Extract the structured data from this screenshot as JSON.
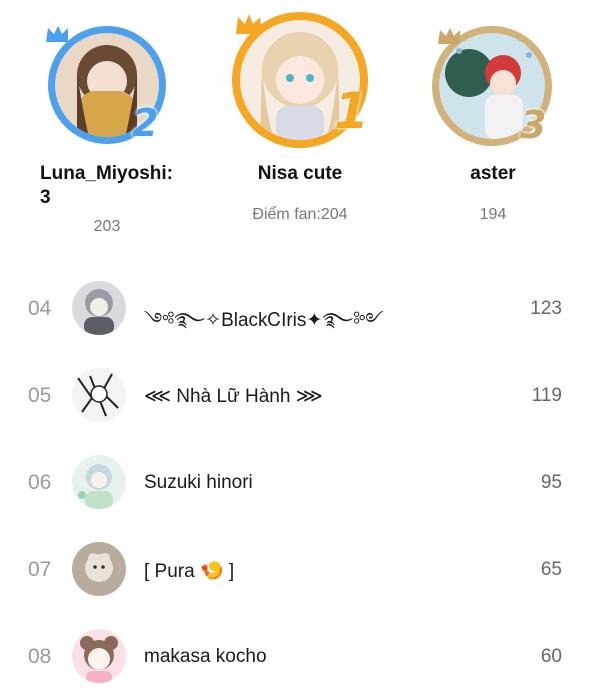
{
  "podium": [
    {
      "rank": "2",
      "name": "Luna_Miyoshi:\n3",
      "score": "203"
    },
    {
      "rank": "1",
      "name": "Nisa cute",
      "score": "Điểm fan:204"
    },
    {
      "rank": "3",
      "name": "aster",
      "score": "194"
    }
  ],
  "list": [
    {
      "rank": "04",
      "name": "༺࿐✧BlackᏟIris✦࿐༻",
      "score": "123"
    },
    {
      "rank": "05",
      "name": "⋘ Nhà Lữ Hành ⋙",
      "score": "119"
    },
    {
      "rank": "06",
      "name": "Suzuki hinori",
      "score": "95"
    },
    {
      "rank": "07",
      "name": "[ Pura 🍤 ]",
      "score": "65"
    },
    {
      "rank": "08",
      "name": "makasa kocho",
      "score": "60"
    }
  ],
  "colors": {
    "gold": "#f5a623",
    "silver_blue": "#4da0ec",
    "bronze": "#d1b27a",
    "rank_text": "#9a9a9a",
    "score_text": "#666666"
  },
  "icons": {
    "crown": "crown-icon",
    "avatar": "avatar"
  }
}
